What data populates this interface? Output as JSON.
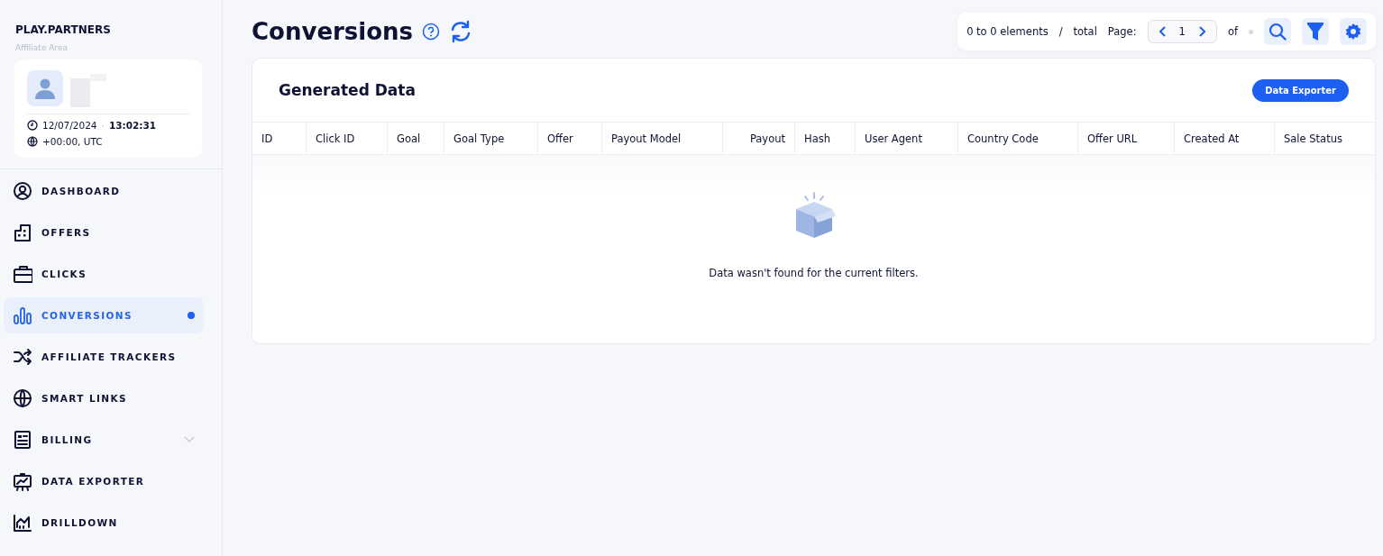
{
  "brand": {
    "name": "PLAY.PARTNERS",
    "subtitle": "Affiliate Area"
  },
  "profile": {
    "date": "12/07/2024",
    "separator": "·",
    "time": "13:02:31",
    "timezone": "+00:00, UTC"
  },
  "sidebar": {
    "items": [
      {
        "label": "DASHBOARD",
        "selected": false,
        "dot": false
      },
      {
        "label": "OFFERS",
        "selected": false,
        "dot": false
      },
      {
        "label": "CLICKS",
        "selected": false,
        "dot": false
      },
      {
        "label": "CONVERSIONS",
        "selected": true,
        "dot": true
      },
      {
        "label": "AFFILIATE TRACKERS",
        "selected": false,
        "dot": false
      },
      {
        "label": "SMART LINKS",
        "selected": false,
        "dot": false
      },
      {
        "label": "BILLING",
        "selected": false,
        "dot": false,
        "expanded": false
      },
      {
        "label": "DATA EXPORTER",
        "selected": false,
        "dot": false
      },
      {
        "label": "DRILLDOWN",
        "selected": false,
        "dot": false
      }
    ]
  },
  "page": {
    "title": "Conversions"
  },
  "pager": {
    "range": "0 to 0 elements",
    "slash": "/",
    "total": "total",
    "page_label": "Page:",
    "page": "1",
    "of": "of"
  },
  "card": {
    "title": "Generated Data",
    "button": "Data Exporter"
  },
  "table": {
    "columns": [
      {
        "label": "ID"
      },
      {
        "label": "Click ID"
      },
      {
        "label": "Goal"
      },
      {
        "label": "Goal Type"
      },
      {
        "label": "Offer"
      },
      {
        "label": "Payout Model"
      },
      {
        "label": "Payout"
      },
      {
        "label": "Hash"
      },
      {
        "label": "User Agent"
      },
      {
        "label": "Country Code"
      },
      {
        "label": "Offer URL"
      },
      {
        "label": "Created At"
      },
      {
        "label": "Sale Status"
      }
    ],
    "empty_message": "Data wasn't found for the current filters."
  }
}
